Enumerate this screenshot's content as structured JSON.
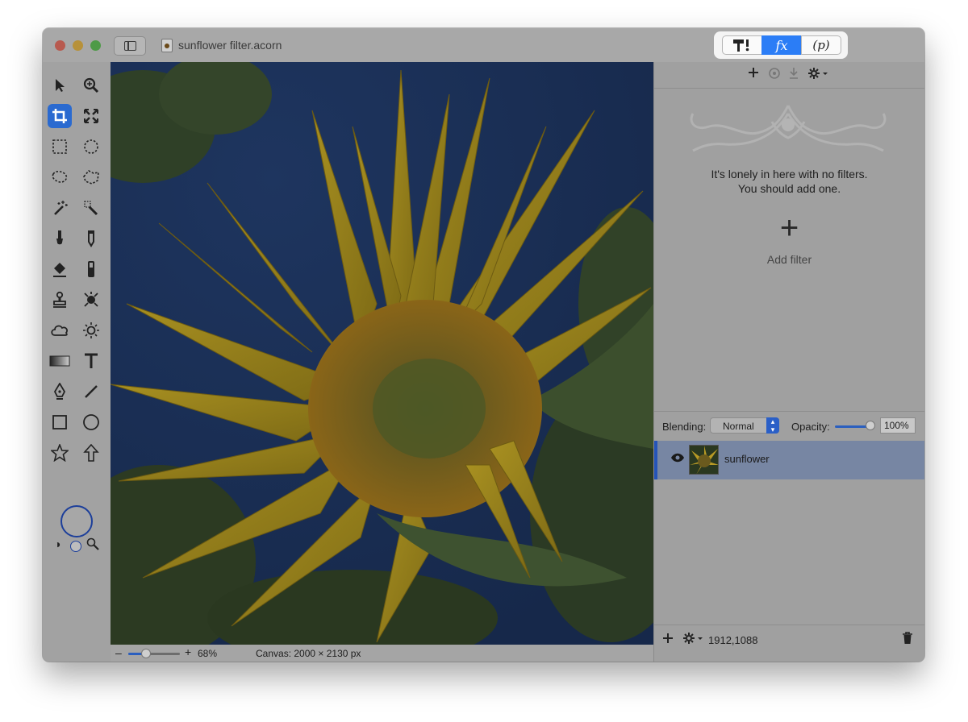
{
  "window": {
    "document_title": "sunflower filter.acorn"
  },
  "palette_tabs": [
    {
      "id": "tools",
      "label": "T!"
    },
    {
      "id": "filters",
      "label": "fx",
      "selected": true
    },
    {
      "id": "properties",
      "label": "(p)"
    }
  ],
  "filters_panel": {
    "empty_line1": "It's lonely in here with no filters.",
    "empty_line2": "You should add one.",
    "add_symbol": "+",
    "add_label": "Add filter"
  },
  "layers_panel": {
    "blending_label": "Blending:",
    "blending_value": "Normal",
    "opacity_label": "Opacity:",
    "opacity_value": "100%",
    "opacity_fraction": 1.0,
    "layers": [
      {
        "name": "sunflower",
        "visible": true,
        "selected": true
      }
    ],
    "coordinates": "1912,1088"
  },
  "status_bar": {
    "zoom_minus": "–",
    "zoom_plus": "+",
    "zoom_value": "68%",
    "zoom_fraction": 0.35,
    "canvas_size": "Canvas: 2000 × 2130 px"
  },
  "colors": {
    "accent": "#2b7df6",
    "selection": "#7786a3",
    "overlay_gray": "#9a9a9a"
  },
  "icons": {
    "toolbox": [
      "arrow-icon",
      "zoom-icon",
      "crop-icon",
      "transform-icon",
      "rect-select-icon",
      "ellipse-select-icon",
      "lasso-icon",
      "polygon-lasso-icon",
      "magic-wand-icon",
      "color-wand-icon",
      "brush-icon",
      "pencil-icon",
      "fill-icon",
      "eraser-icon",
      "clone-stamp-icon",
      "retouch-icon",
      "cloud-icon",
      "sun-icon",
      "gradient-icon",
      "text-icon",
      "pen-icon",
      "line-icon",
      "rectangle-icon",
      "circle-icon",
      "star-icon",
      "arrow-shape-icon"
    ]
  }
}
